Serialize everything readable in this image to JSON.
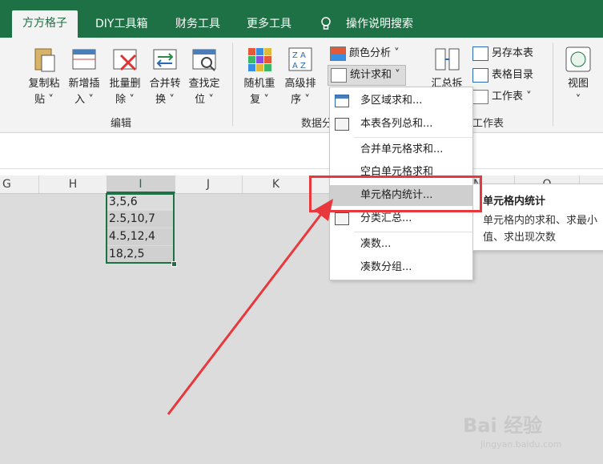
{
  "tabs": [
    {
      "label": "方方格子",
      "active": true
    },
    {
      "label": "DIY工具箱",
      "active": false
    },
    {
      "label": "财务工具",
      "active": false
    },
    {
      "label": "更多工具",
      "active": false
    },
    {
      "label": "操作说明搜索",
      "active": false
    }
  ],
  "ribbon": {
    "edit_group": {
      "label": "编辑",
      "buttons": [
        {
          "line1": "复制粘",
          "line2": "贴"
        },
        {
          "line1": "新增插",
          "line2": "入"
        },
        {
          "line1": "批量删",
          "line2": "除"
        },
        {
          "line1": "合并转",
          "line2": "换"
        },
        {
          "line1": "查找定",
          "line2": "位"
        }
      ]
    },
    "data_group": {
      "label": "数据分",
      "buttons": [
        {
          "line1": "随机重",
          "line2": "复"
        },
        {
          "line1": "高级排",
          "line2": "序"
        }
      ],
      "small_buttons": [
        "颜色分析",
        "统计求和"
      ]
    },
    "summary_button": "汇总拆",
    "worksheet_group": {
      "label": "工作表",
      "small_buttons": [
        "另存本表",
        "表格目录",
        "工作表"
      ]
    },
    "view_button": "视图"
  },
  "columns": [
    "G",
    "H",
    "I",
    "J",
    "K",
    "N",
    "O"
  ],
  "cells": [
    "3,5,6",
    "2.5,10,7",
    "4.5,12,4",
    "18,2,5"
  ],
  "menu": {
    "items": [
      {
        "label": "多区域求和...",
        "icon": "multi-area-sum-icon"
      },
      {
        "label": "本表各列总和...",
        "icon": "column-total-icon"
      },
      {
        "label": "合并单元格求和...",
        "icon": ""
      },
      {
        "label": "空白单元格求和",
        "icon": ""
      },
      {
        "label": "单元格内统计...",
        "icon": "",
        "highlighted": true
      },
      {
        "label": "分类汇总...",
        "icon": "category-summary-icon"
      },
      {
        "label": "凑数...",
        "icon": ""
      },
      {
        "label": "凑数分组...",
        "icon": ""
      }
    ]
  },
  "tooltip": {
    "title": "单元格内统计",
    "desc": "单元格内的求和、求最小值、求出现次数"
  },
  "watermark": {
    "main": "Bai 经验",
    "sub": "jingyan.baidu.com"
  },
  "colors": {
    "accent": "#1e7145",
    "annotation": "#e8383d"
  }
}
